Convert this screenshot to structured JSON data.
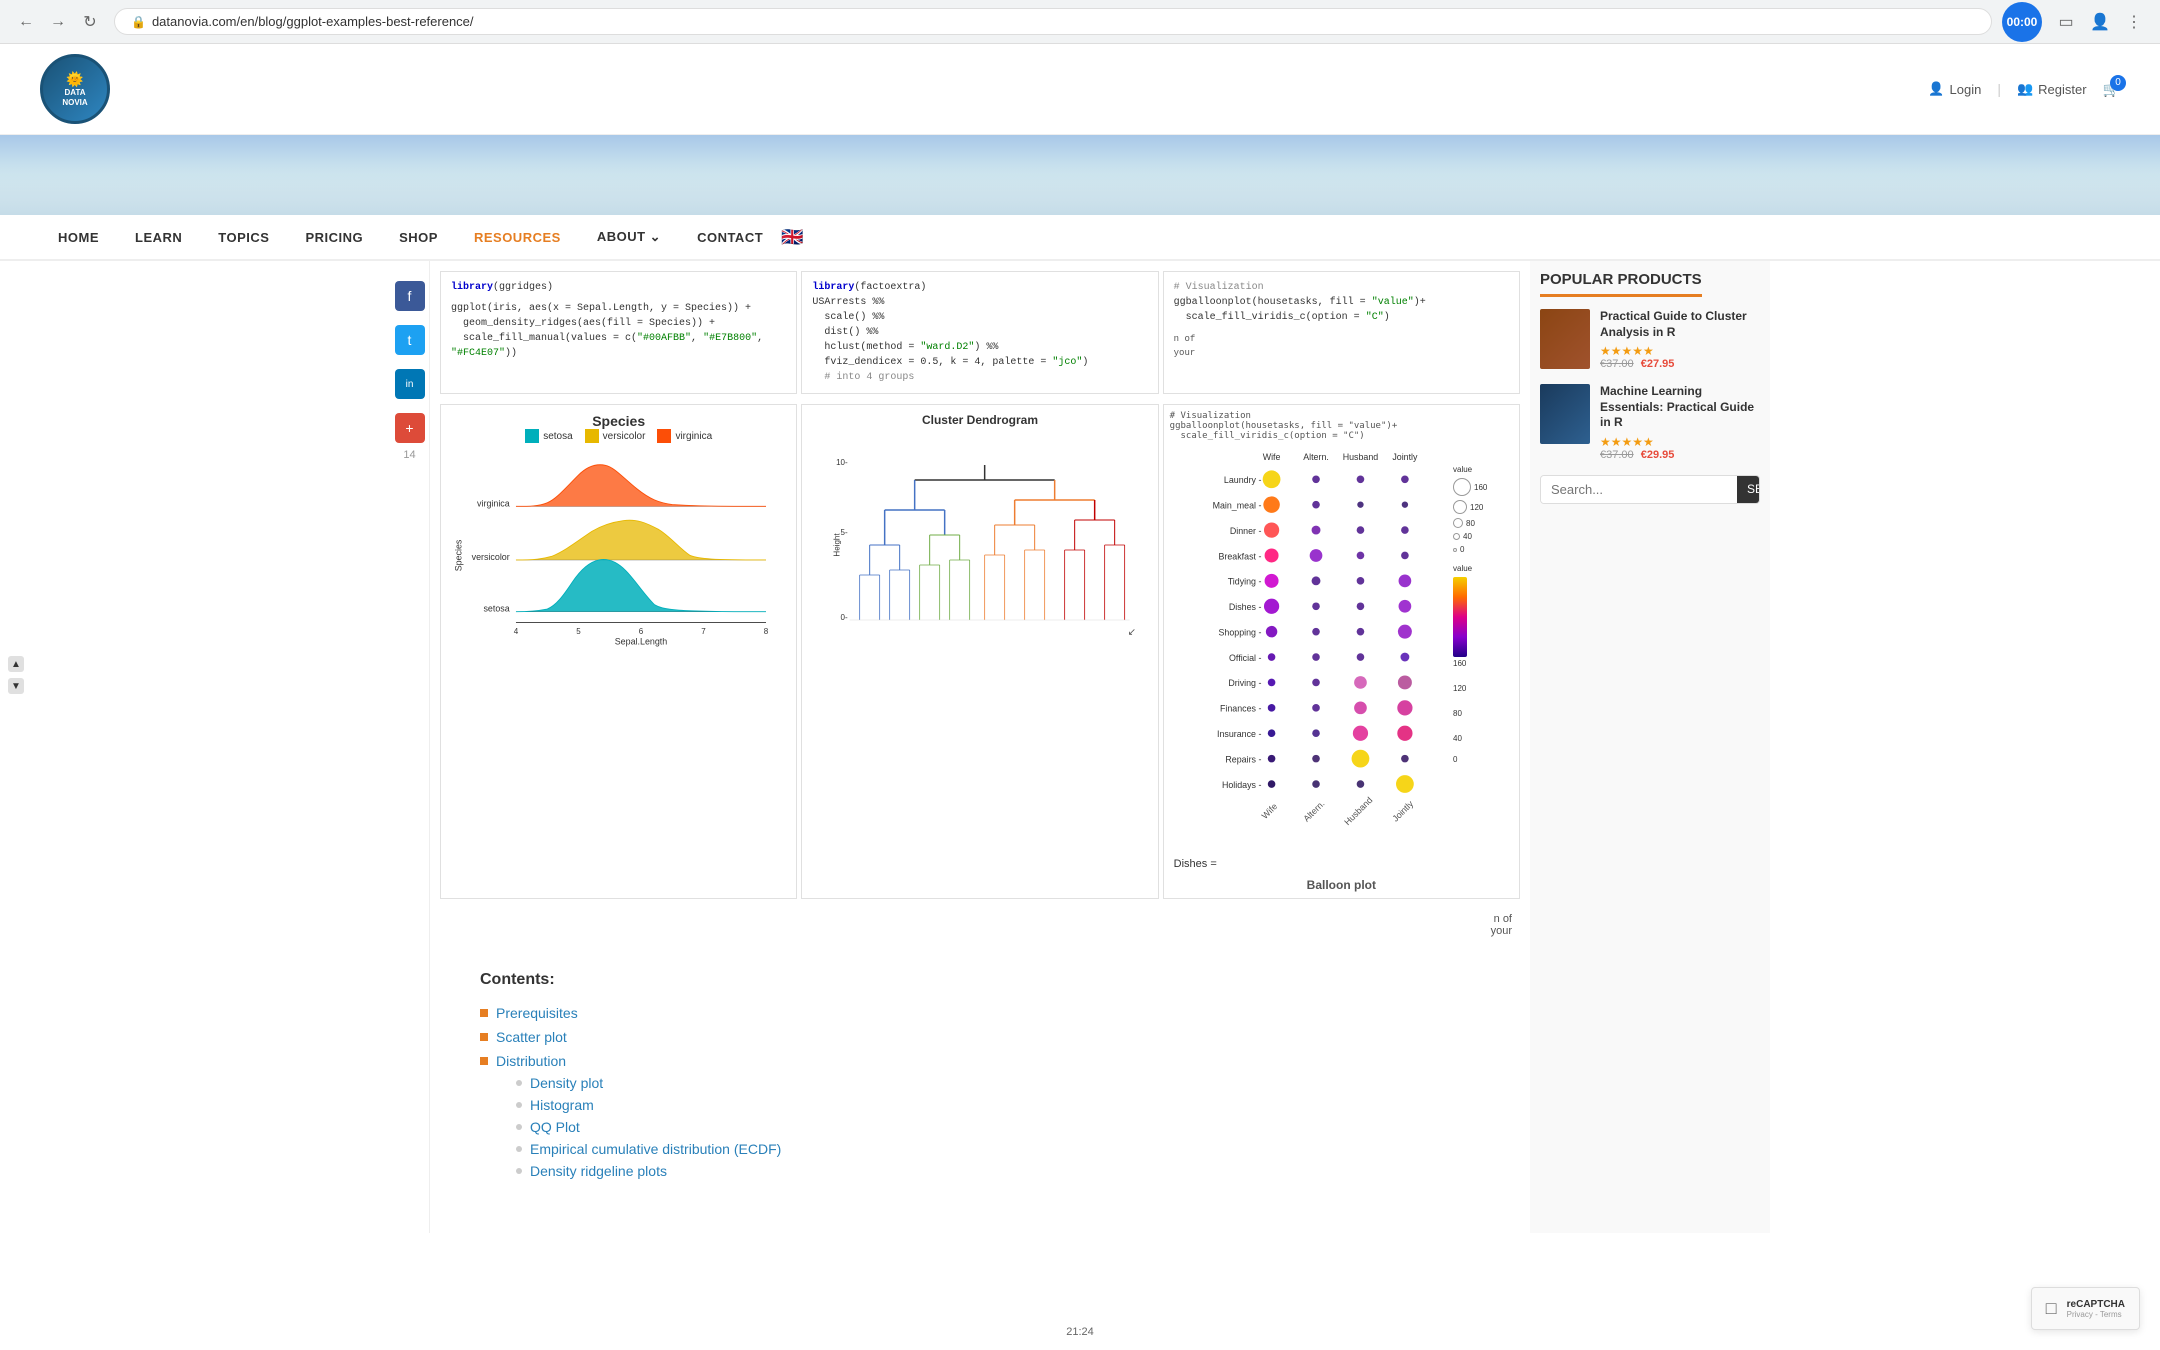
{
  "browser": {
    "url": "datanovia.com/en/blog/ggplot-examples-best-reference/",
    "timer": "00:00"
  },
  "header": {
    "logo_line1": "DATA",
    "logo_line2": "NOVIA",
    "login": "Login",
    "register": "Register",
    "cart_count": "0"
  },
  "nav": {
    "items": [
      "HOME",
      "LEARN",
      "TOPICS",
      "PRICING",
      "SHOP",
      "RESOURCES",
      "ABOUT",
      "CONTACT"
    ]
  },
  "code_blocks": {
    "block1": {
      "lines": [
        "library(ggridges)",
        "",
        "ggplot(iris, aes(x = Sepal.Length, y = Species)) +",
        "  geom_density_ridges(aes(fill = Species)) +",
        "  scale_fill_manual(values = c(\"#00AFBB\", \"#E7B800\", \"#FC4E07\"))"
      ]
    },
    "block2": {
      "lines": [
        "library(factoextra)",
        "USArrests %%",
        "  scale() %%",
        "  dist() %%",
        "  hclust(method = \"ward.D2\") %%",
        "  fviz_dendicex = 0.5, k = 4, palette = \"jco\")",
        "  # into 4 groups"
      ]
    },
    "block3": {
      "lines": [
        "# Visualization",
        "ggballoonplot(housetasks, fill = \"value\")+",
        "  scale_fill_viridis_c(option = \"C\")"
      ]
    }
  },
  "ridge_chart": {
    "title": "Species",
    "legend": [
      {
        "name": "setosa",
        "color": "#00AFBB"
      },
      {
        "name": "versicolor",
        "color": "#E7B800"
      },
      {
        "name": "virginica",
        "color": "#FC4E07"
      }
    ],
    "x_label": "Sepal.Length",
    "y_label": "Species",
    "x_ticks": [
      "4",
      "5",
      "6",
      "7",
      "8"
    ],
    "y_ticks": [
      "virginica",
      "versicolor",
      "setosa"
    ]
  },
  "cluster_chart": {
    "title": "Cluster Dendrogram",
    "y_label": "Height",
    "y_ticks": [
      "0-",
      "5-",
      "10-"
    ]
  },
  "balloon_chart": {
    "rows": [
      "Laundry",
      "Main_meal",
      "Dinner",
      "Breakfast",
      "Tidying",
      "Dishes",
      "Shopping",
      "Official",
      "Driving",
      "Finances",
      "Insurance",
      "Repairs",
      "Holidays"
    ],
    "cols": [
      "Wife",
      "Alternating",
      "Husband",
      "Jointly"
    ],
    "legend_values": [
      "0",
      "40",
      "80",
      "120",
      "160"
    ],
    "dishes_text": "Dishes ="
  },
  "contents": {
    "title": "Contents:",
    "items": [
      {
        "text": "Prerequisites",
        "type": "top"
      },
      {
        "text": "Scatter plot",
        "type": "top"
      },
      {
        "text": "Distribution",
        "type": "top",
        "subitems": [
          {
            "text": "Density plot"
          },
          {
            "text": "Histogram"
          },
          {
            "text": "QQ Plot"
          },
          {
            "text": "Empirical cumulative distribution (ECDF)"
          },
          {
            "text": "Density ridgeline plots"
          }
        ]
      }
    ]
  },
  "sidebar": {
    "popular_products_title": "POPULAR PRODUCTS",
    "products": [
      {
        "name": "Practical Guide to Cluster Analysis in R",
        "stars": "★★★★★",
        "price_old": "€37.00",
        "price_new": "€27.95",
        "color": "brown"
      },
      {
        "name": "Machine Learning Essentials: Practical Guide in R",
        "stars": "★★★★★",
        "price_old": "€37.00",
        "price_new": "€29.95",
        "color": "blue"
      }
    ],
    "search_placeholder": "Search..."
  },
  "social": {
    "icons": [
      {
        "name": "facebook",
        "symbol": "f",
        "class": "social-fb"
      },
      {
        "name": "twitter",
        "symbol": "t",
        "class": "social-tw"
      },
      {
        "name": "linkedin",
        "symbol": "in",
        "class": "social-li"
      },
      {
        "name": "plus",
        "symbol": "+",
        "class": "social-plus"
      }
    ],
    "count": "14"
  }
}
